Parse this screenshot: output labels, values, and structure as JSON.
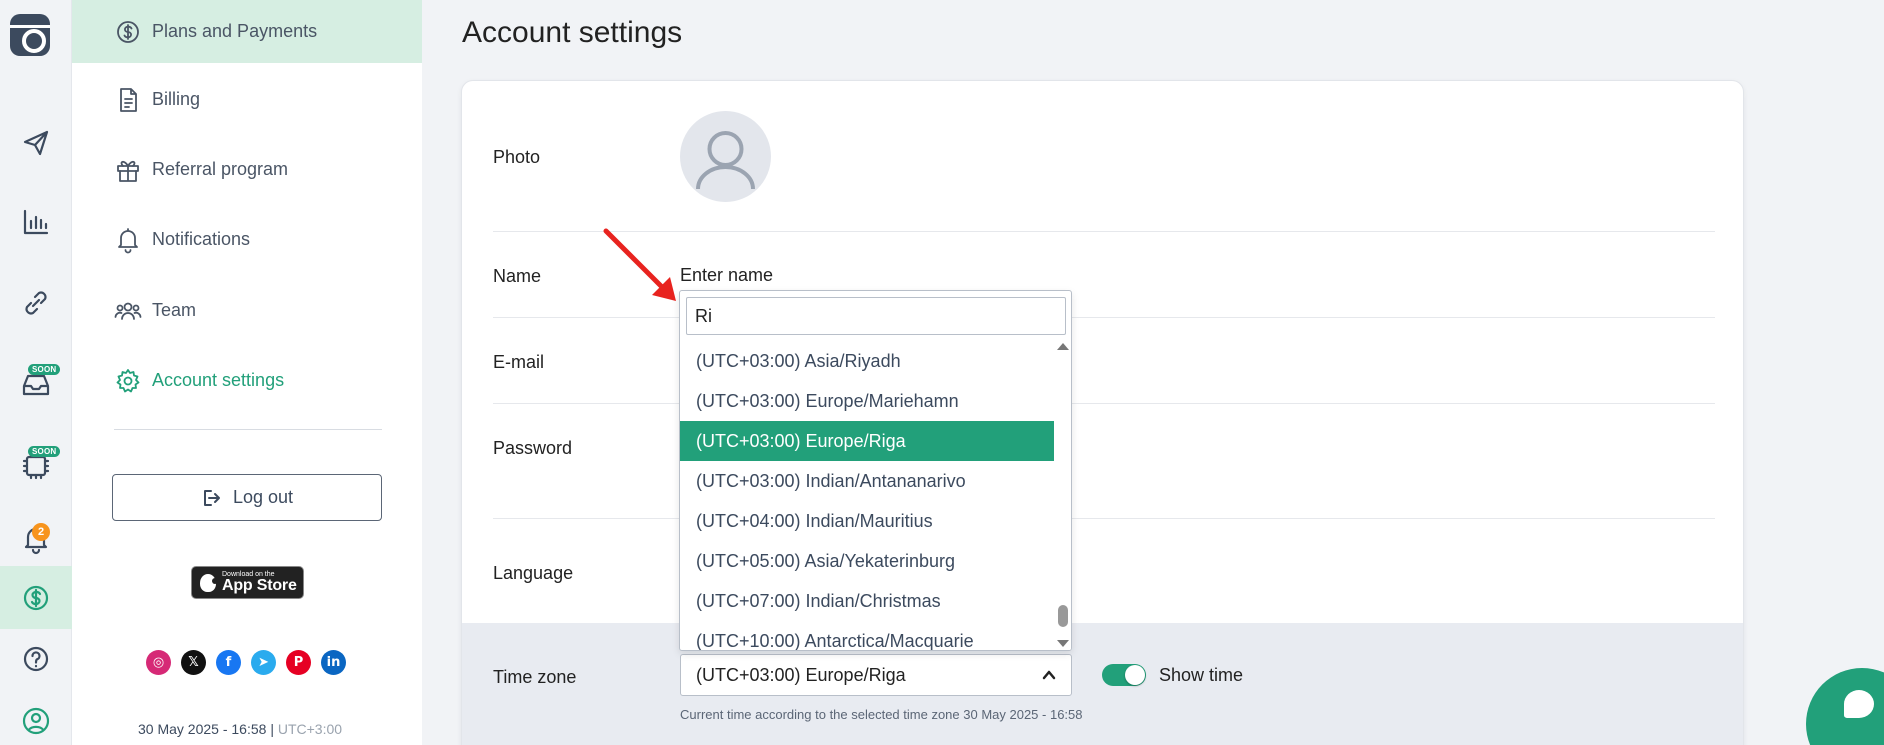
{
  "sidebar_rail": {
    "items": [
      {
        "icon": "send-icon"
      },
      {
        "icon": "analytics-icon"
      },
      {
        "icon": "link-icon"
      },
      {
        "icon": "inbox-icon",
        "badge": "SOON"
      },
      {
        "icon": "ai-icon",
        "badge": "SOON"
      },
      {
        "icon": "bell-icon",
        "count": "2"
      },
      {
        "icon": "dollar-icon",
        "active": true
      },
      {
        "icon": "help-icon"
      },
      {
        "icon": "profile-icon"
      }
    ]
  },
  "settings_menu": {
    "items": [
      {
        "label": "Plans and Payments",
        "icon": "dollar-circle-icon"
      },
      {
        "label": "Billing",
        "icon": "document-icon"
      },
      {
        "label": "Referral program",
        "icon": "gift-icon"
      },
      {
        "label": "Notifications",
        "icon": "bell-icon"
      },
      {
        "label": "Team",
        "icon": "team-icon"
      },
      {
        "label": "Account settings",
        "icon": "gear-icon"
      }
    ],
    "logout_label": "Log out",
    "appstore": {
      "small": "Download on the",
      "big": "App Store"
    },
    "socials": [
      "instagram-icon",
      "x-icon",
      "facebook-icon",
      "telegram-icon",
      "pinterest-icon",
      "linkedin-icon"
    ],
    "footer_datetime": "30 May 2025 - 16:58",
    "footer_sep": "|",
    "footer_tz": "UTC+3:00"
  },
  "main": {
    "title": "Account settings",
    "labels": {
      "photo": "Photo",
      "name": "Name",
      "email": "E-mail",
      "password": "Password",
      "language": "Language",
      "timezone": "Time zone"
    },
    "name_value": "Enter name",
    "timezone_selected": "(UTC+03:00) Europe/Riga",
    "show_time_label": "Show time",
    "show_time_on": true,
    "current_time_note": "Current time according to the selected time zone 30 May 2025 - 16:58"
  },
  "timezone_dropdown": {
    "search_value": "Ri",
    "options": [
      "(UTC+03:00) Asia/Riyadh",
      "(UTC+03:00) Europe/Mariehamn",
      "(UTC+03:00) Europe/Riga",
      "(UTC+03:00) Indian/Antananarivo",
      "(UTC+04:00) Indian/Mauritius",
      "(UTC+05:00) Asia/Yekaterinburg",
      "(UTC+07:00) Indian/Christmas",
      "(UTC+10:00) Antarctica/Macquarie"
    ],
    "selected_index": 2
  },
  "colors": {
    "accent": "#22a07a",
    "accent_light": "#d6eee2",
    "badge_orange": "#f7941d",
    "annotation_red": "#e8231f"
  }
}
